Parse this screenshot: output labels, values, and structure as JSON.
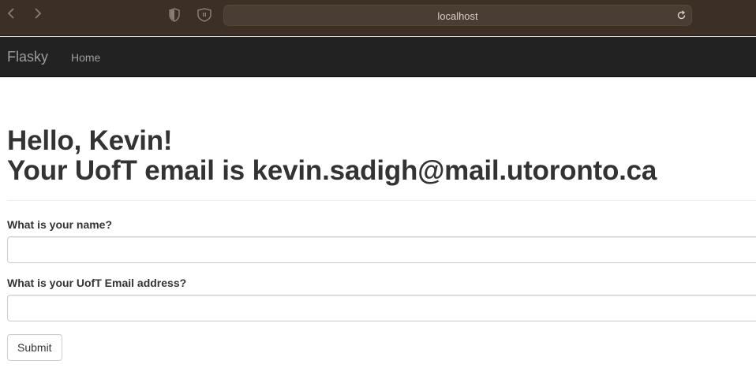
{
  "browser": {
    "url": "localhost",
    "back_icon": "chevron-left-icon",
    "forward_icon": "chevron-right-icon",
    "reload_icon": "reload-icon"
  },
  "navbar": {
    "brand": "Flasky",
    "items": [
      {
        "label": "Home"
      }
    ]
  },
  "main": {
    "greeting": "Hello, Kevin!",
    "email_line": "Your UofT email is kevin.sadigh@mail.utoronto.ca",
    "form": {
      "name_label": "What is your name?",
      "name_value": "",
      "email_label": "What is your UofT Email address?",
      "email_value": "",
      "submit_label": "Submit"
    }
  },
  "colors": {
    "browser_bar": "#3b2f26",
    "navbar": "#222222",
    "heading_text": "#333333"
  }
}
